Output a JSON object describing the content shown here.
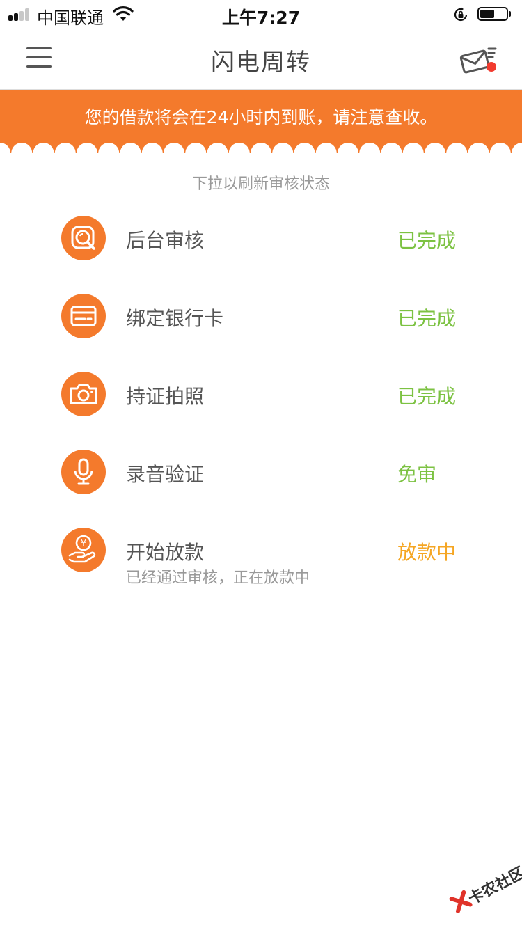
{
  "status_bar": {
    "carrier": "中国联通",
    "time": "上午7:27",
    "battery_level": 0.55
  },
  "nav": {
    "title": "闪电周转",
    "menu_icon": "hamburger-menu-icon",
    "message_icon": "envelope-notification-icon",
    "has_unread": true
  },
  "banner": {
    "text": "您的借款将会在24小时内到账，请注意查收。"
  },
  "hint": "下拉以刷新审核状态",
  "steps": [
    {
      "icon": "search-review-icon",
      "label": "后台审核",
      "status": "已完成"
    },
    {
      "icon": "bank-card-icon",
      "label": "绑定银行卡",
      "status": "已完成"
    },
    {
      "icon": "camera-icon",
      "label": "持证拍照",
      "status": "已完成"
    },
    {
      "icon": "microphone-icon",
      "label": "录音验证",
      "status": "免审"
    },
    {
      "icon": "money-hand-icon",
      "label": "开始放款",
      "status": "放款中",
      "sub": "已经通过审核，正在放款中"
    }
  ],
  "colors": {
    "accent": "#f47a2c",
    "done": "#7cc242",
    "pending": "#f5a623"
  },
  "watermark": "卡农社区"
}
